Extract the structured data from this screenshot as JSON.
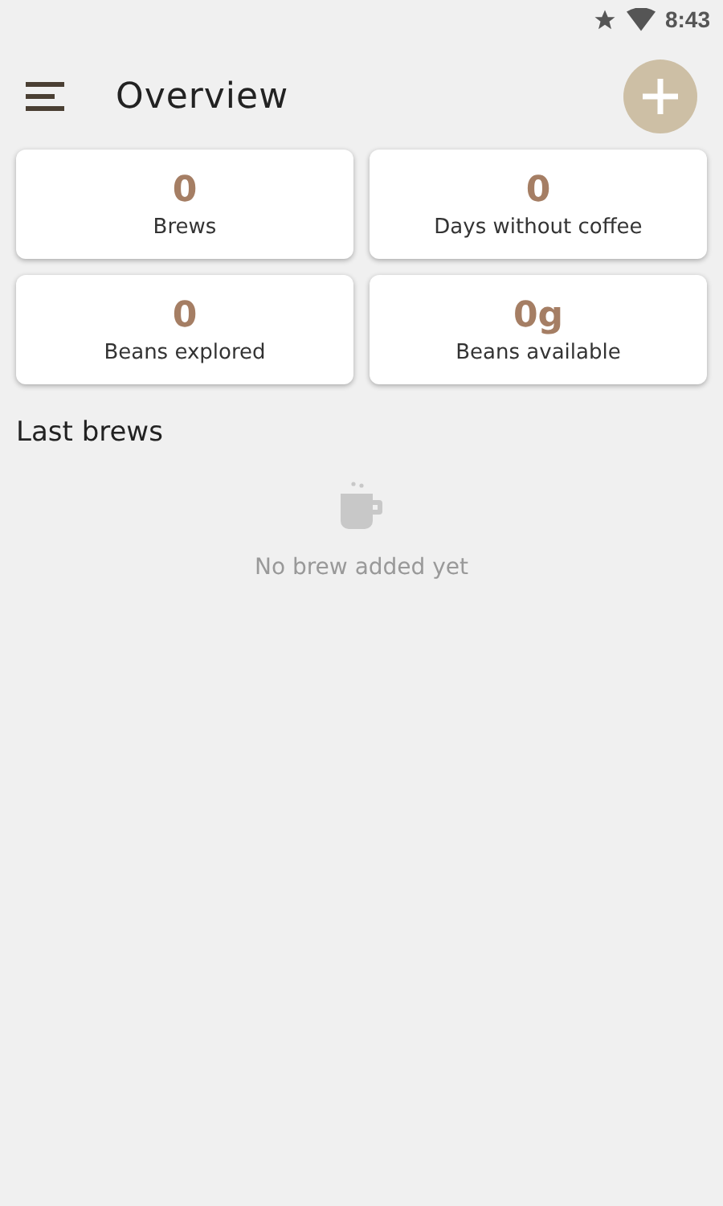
{
  "status_bar": {
    "time": "8:43"
  },
  "app_bar": {
    "title": "Overview"
  },
  "stats": [
    {
      "value": "0",
      "label": "Brews"
    },
    {
      "value": "0",
      "label": "Days without coffee"
    },
    {
      "value": "0",
      "label": "Beans explored"
    },
    {
      "value": "0g",
      "label": "Beans available"
    }
  ],
  "last_brews": {
    "heading": "Last brews",
    "empty_text": "No brew added yet"
  }
}
